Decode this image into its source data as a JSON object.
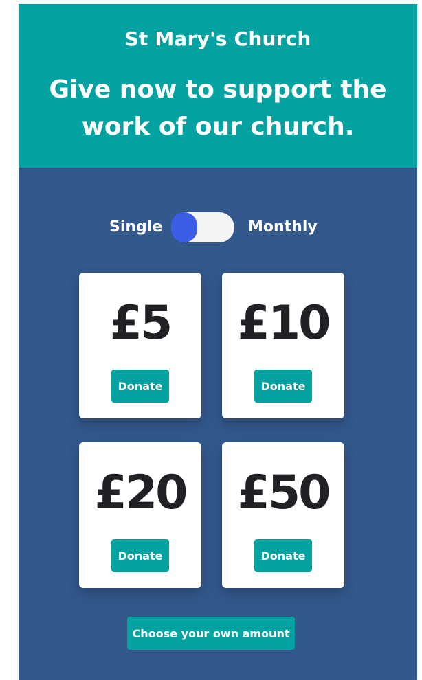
{
  "header": {
    "org_name": "St Mary's Church",
    "headline": "Give now to support the work of our church."
  },
  "frequency_toggle": {
    "left_label": "Single",
    "right_label": "Monthly",
    "selected": "Single"
  },
  "amounts": [
    {
      "value": "£5",
      "button_label": "Donate"
    },
    {
      "value": "£10",
      "button_label": "Donate"
    },
    {
      "value": "£20",
      "button_label": "Donate"
    },
    {
      "value": "£50",
      "button_label": "Donate"
    }
  ],
  "custom_amount": {
    "label": "Choose your own amount"
  },
  "colors": {
    "teal": "#04a3a2",
    "navy": "#32588c",
    "toggle_knob": "#3d5de6",
    "amount_text": "#202124"
  }
}
